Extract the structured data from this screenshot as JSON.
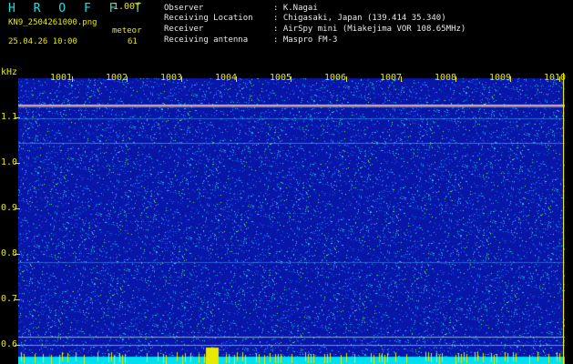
{
  "header": {
    "app_title": "H R O F F T",
    "version": "1.00f",
    "filename": "KN9_2504261000.png",
    "label_meteor": "meteor",
    "datetime": "25.04.26 10:00",
    "meteor_count": "61",
    "info": [
      {
        "label": "Observer",
        "value": ": K.Nagai"
      },
      {
        "label": "Receiving Location",
        "value": ": Chigasaki, Japan (139.414 35.340)"
      },
      {
        "label": "Receiver",
        "value": ": AirSpy mini (Miakejima VOR 108.65MHz)"
      },
      {
        "label": "Receiving antenna",
        "value": ": Maspro FM-3"
      }
    ]
  },
  "axes": {
    "y_unit": "kHz",
    "y_ticks": [
      "1.1",
      "1.0",
      "0.9",
      "0.8",
      "0.7",
      "0.6"
    ],
    "x_ticks": [
      "1001",
      "1002",
      "1003",
      "1004",
      "1005",
      "1006",
      "1007",
      "1008",
      "1009",
      "1010"
    ]
  },
  "colors": {
    "background": "#000000",
    "label_yellow": "#e8e800",
    "label_white": "#e8e8e8",
    "title_cyan": "#18e0e0",
    "spectrogram_base": "#0a1a9c",
    "bottom_bar": "#00e0f0"
  }
}
